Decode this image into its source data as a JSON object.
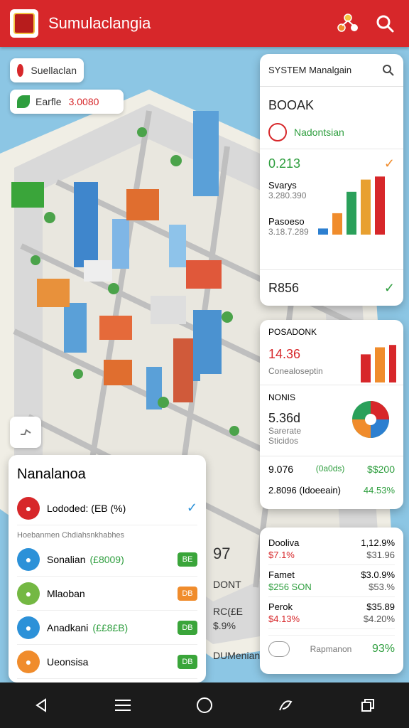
{
  "header": {
    "title": "Sumulaclangia",
    "icons": [
      "app-logo",
      "network-icon",
      "search-icon"
    ]
  },
  "map": {
    "pill_top": {
      "label": "Suellaclan"
    },
    "pill_second": {
      "label": "Earfle",
      "value": "3.0080"
    }
  },
  "right_panel": {
    "search_placeholder": "SYSTEM Manalgain",
    "title": "BOOAK",
    "subtitle": "Nadontsian",
    "value1": "0.213",
    "metric1_label": "Svarys",
    "metric1_value": "3.280.390",
    "metric2_label": "Pasoeso",
    "metric2_value": "3.18.7.289",
    "value2": "R856",
    "bars1": [
      0.1,
      0.35,
      0.7,
      0.9,
      0.95
    ],
    "bar_colors": [
      "#2c7fd0",
      "#f08c2c",
      "#2aa05a",
      "#e8a030",
      "#d7272a"
    ]
  },
  "right_panel2": {
    "label1": "POSADONK",
    "value1": "14.36",
    "sub1": "Conealoseptin",
    "label2": "NONIS",
    "value2": "5.36d",
    "sub2a": "Sarerate",
    "sub2b": "Sticidos",
    "bars2": [
      0.0,
      0.0,
      0.6,
      0.75,
      0.8
    ],
    "row1_left": "9.076",
    "row1_mid": "(0a0ds)",
    "row1_right": "$$200",
    "row2_left": "2.8096 (Idoeeain)",
    "row2_right": "44.53%"
  },
  "right_panel3": {
    "rows": [
      {
        "l1": "Dooliva",
        "r1": "1,12.9%",
        "l2": "$7.1%",
        "r2": "$31.96"
      },
      {
        "l1": "Famet",
        "r1": "$3.0.9%",
        "l2": "$256 SON",
        "r2": "$53.%"
      },
      {
        "l1": "Perok",
        "r1": "$35.89",
        "l2": "$4.13%",
        "r2": "$4.20%"
      }
    ],
    "footer_label": "Rapmanon",
    "footer_value": "93%"
  },
  "left_panel": {
    "title": "Nanalanoa",
    "row0": {
      "label": "Lododed: (EB (%)",
      "check": true
    },
    "section_label": "Hoebanmen Chdiahsnkhabhes",
    "rows": [
      {
        "label": "Sonalian",
        "extra": "(£8009)",
        "badge": "BE",
        "badge_color": "#3aa53a",
        "icon_color": "#2c91d8"
      },
      {
        "label": "Mlaoban",
        "extra": "",
        "badge": "DB",
        "badge_color": "#f08c2c",
        "icon_color": "#74b843"
      },
      {
        "label": "Anadkani",
        "extra": "(££8£B)",
        "badge": "DB",
        "badge_color": "#3aa53a",
        "icon_color": "#2c91d8"
      },
      {
        "label": "Ueonsisa",
        "extra": "",
        "badge": "DB",
        "badge_color": "#3aa53a",
        "icon_color": "#f08c2c"
      }
    ]
  },
  "overlay_mid": {
    "value": "97",
    "label1": "DONT",
    "label2": "RC(£E",
    "label3": "$.9%",
    "label4": "DUMenian"
  },
  "colors": {
    "brand_red": "#d7272a",
    "accent_green": "#2e9e3e"
  }
}
